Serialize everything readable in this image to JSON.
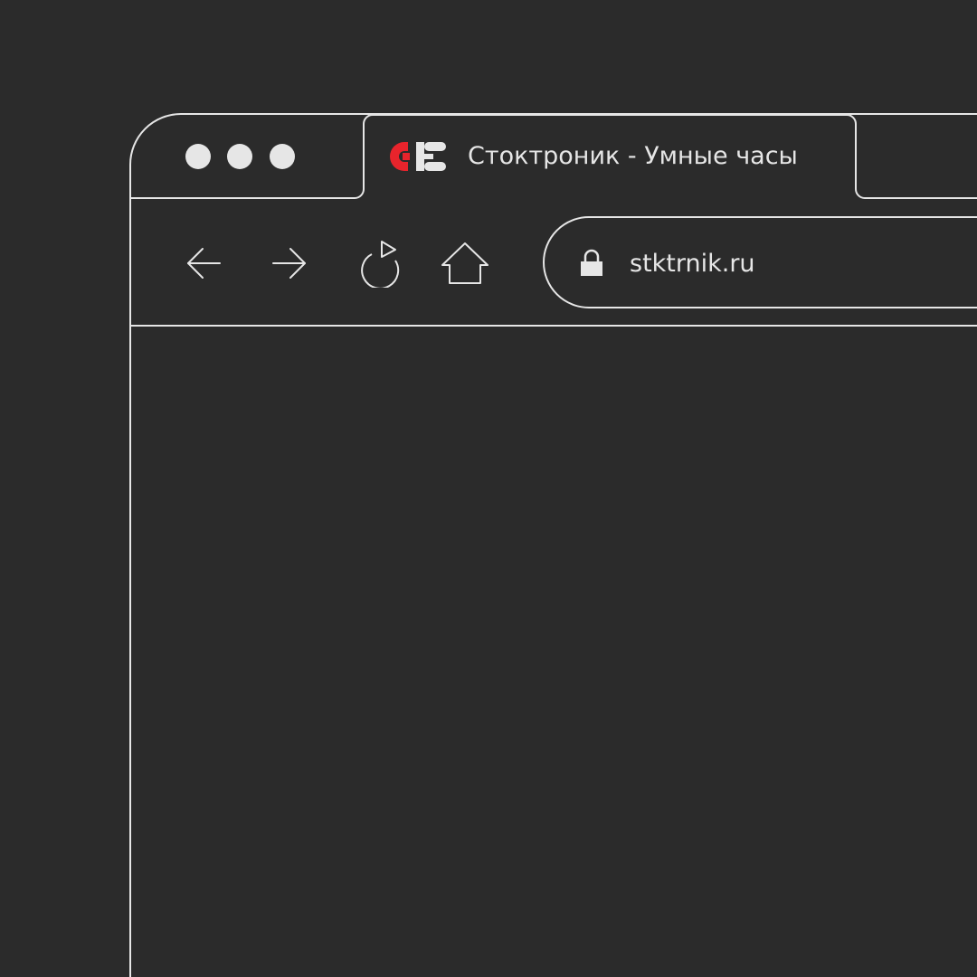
{
  "window": {
    "traffic_lights": [
      "close",
      "minimize",
      "maximize"
    ]
  },
  "tab": {
    "title": "Стоктроник - Умные часы",
    "favicon": "stoktronik-logo",
    "favicon_colors": {
      "primary": "#e8242c",
      "secondary": "#e6e6e6"
    }
  },
  "toolbar": {
    "back_icon": "arrow-left-icon",
    "forward_icon": "arrow-right-icon",
    "reload_icon": "reload-icon",
    "home_icon": "home-icon"
  },
  "address_bar": {
    "lock_icon": "lock-icon",
    "url": "stktrnik.ru"
  },
  "theme": {
    "background": "#2b2b2b",
    "line": "#e6e6e6",
    "accent": "#e8242c"
  }
}
